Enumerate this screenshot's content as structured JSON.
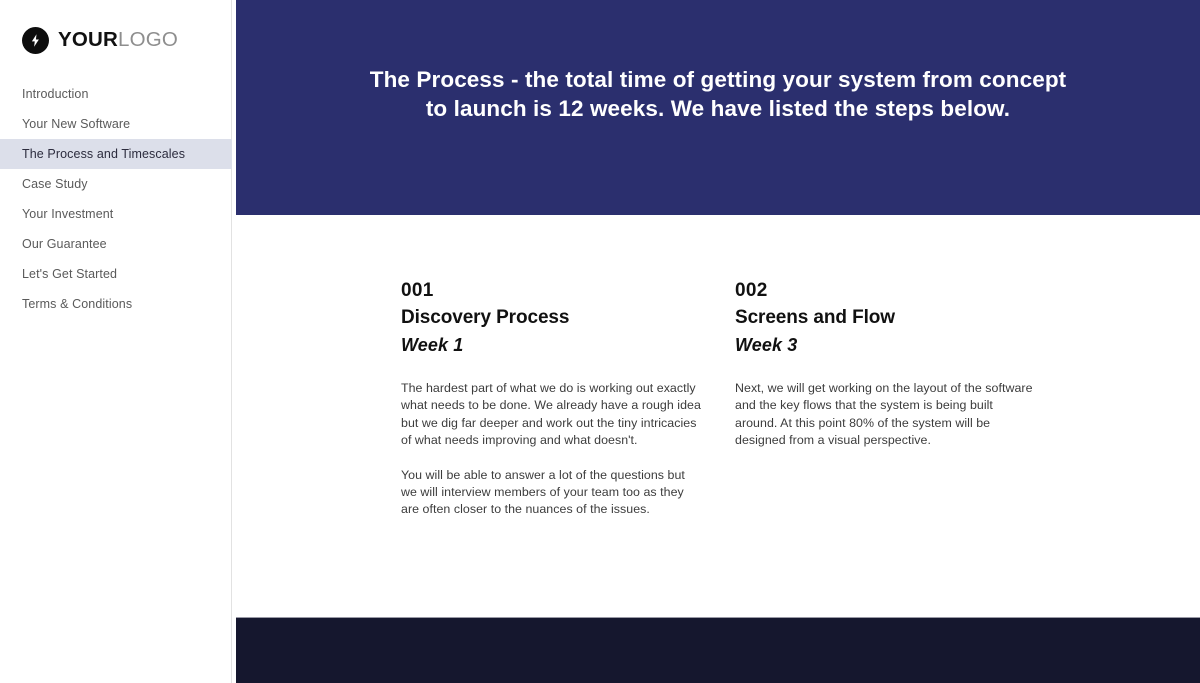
{
  "brand": {
    "logo_icon": "lightning-bolt-icon",
    "name_bold": "YOUR",
    "name_light": "LOGO"
  },
  "colors": {
    "header_band": "#2b2f6e",
    "footer_band": "#15172e",
    "active_nav": "#dcdfea",
    "sidebar_bg": "#ffffff",
    "canvas_bg": "#ffffff",
    "heading_text": "#111111",
    "body_text": "#3c3c3c",
    "nav_text": "#5a5a5a",
    "logo_light_text": "#8e8e8e"
  },
  "sidebar": {
    "items": [
      {
        "label": "Introduction",
        "active": false
      },
      {
        "label": "Your New Software",
        "active": false
      },
      {
        "label": "The Process and Timescales",
        "active": true
      },
      {
        "label": "Case Study",
        "active": false
      },
      {
        "label": "Your Investment",
        "active": false
      },
      {
        "label": "Our Guarantee",
        "active": false
      },
      {
        "label": "Let's Get Started",
        "active": false
      },
      {
        "label": "Terms & Conditions",
        "active": false
      }
    ]
  },
  "header": {
    "title": "The Process - the total time of getting your system from concept to launch is 12 weeks. We have listed the steps below."
  },
  "steps": [
    {
      "number": "001",
      "title": "Discovery Process",
      "week": "Week 1",
      "paragraphs": [
        "The hardest part of what we do is working out exactly what needs to be done. We already have a rough idea but we dig far deeper and work out the tiny intricacies of what needs improving and what doesn't.",
        "You will be able to answer a lot of the questions but we will interview members of your team too as they are often closer to the nuances of the issues."
      ]
    },
    {
      "number": "002",
      "title": "Screens and Flow",
      "week": "Week 3",
      "paragraphs": [
        "Next, we will get working on the layout of the software and the key flows that the system is being built around. At this point 80% of the system will be designed from a visual perspective."
      ]
    }
  ]
}
